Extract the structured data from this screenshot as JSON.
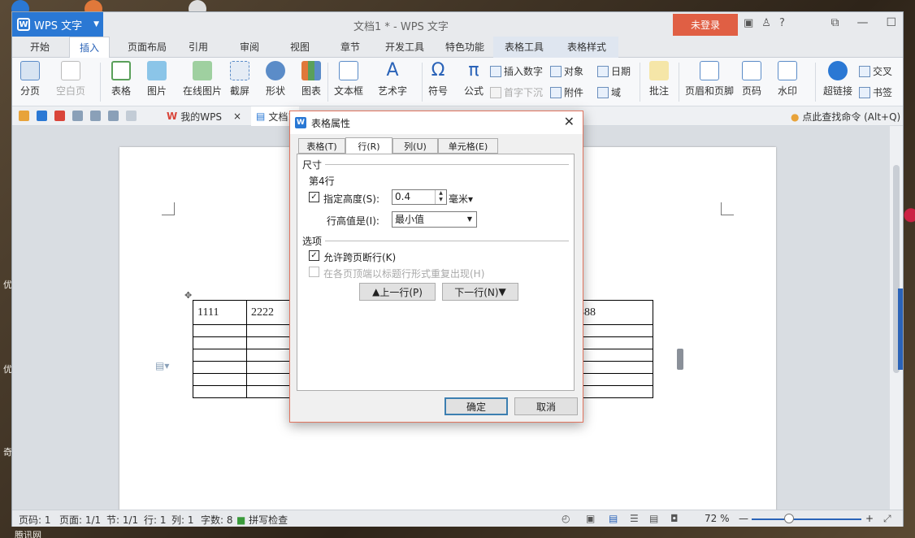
{
  "desktop": {
    "words": [
      "优",
      "优",
      "奇",
      "腾讯网"
    ]
  },
  "window": {
    "title": "文档1 * - WPS 文字",
    "app_name": "WPS 文字",
    "login": "未登录"
  },
  "menu": {
    "items": [
      "开始",
      "插入",
      "页面布局",
      "引用",
      "审阅",
      "视图",
      "章节",
      "开发工具",
      "特色功能",
      "表格工具",
      "表格样式"
    ],
    "active": "插入"
  },
  "ribbon": {
    "big": [
      "分页",
      "空白页",
      "表格",
      "图片",
      "在线图片",
      "截屏",
      "形状",
      "图表",
      "文本框",
      "艺术字",
      "符号",
      "公式",
      "批注",
      "页眉和页脚",
      "页码",
      "水印",
      "超链接"
    ],
    "small": [
      "插入数字",
      "对象",
      "日期",
      "首字下沉",
      "附件",
      "域",
      "交叉",
      "书签"
    ]
  },
  "quickbar": {
    "tab1": "我的WPS",
    "tab2": "文档1",
    "find": "点此查找命令 (Alt+Q)"
  },
  "table": {
    "row1": [
      "1111",
      "2222",
      "",
      "",
      "",
      "",
      "",
      "8888"
    ]
  },
  "status": {
    "pagecode": "页码: 1",
    "pages": "页面: 1/1",
    "section": "节: 1/1",
    "row": "行: 1",
    "col": "列: 1",
    "chars": "字数: 8",
    "spell": "拼写检查",
    "zoom": "72 %"
  },
  "dialog": {
    "title": "表格属性",
    "tabs": [
      "表格(T)",
      "行(R)",
      "列(U)",
      "单元格(E)"
    ],
    "size_group": "尺寸",
    "row_label": "第4行",
    "specify_height": "指定高度(S):",
    "height_value": "0.4",
    "unit": "毫米",
    "row_height_is": "行高值是(I):",
    "row_height_mode": "最小值",
    "options_group": "选项",
    "allow_break": "允许跨页断行(K)",
    "repeat_header": "在各页顶端以标题行形式重复出现(H)",
    "prev_row": "上一行(P)",
    "next_row": "下一行(N)",
    "ok": "确定",
    "cancel": "取消"
  },
  "colors": {
    "accent": "#2a78d4",
    "login": "#e05f44",
    "dialog_border": "#e0735e"
  }
}
